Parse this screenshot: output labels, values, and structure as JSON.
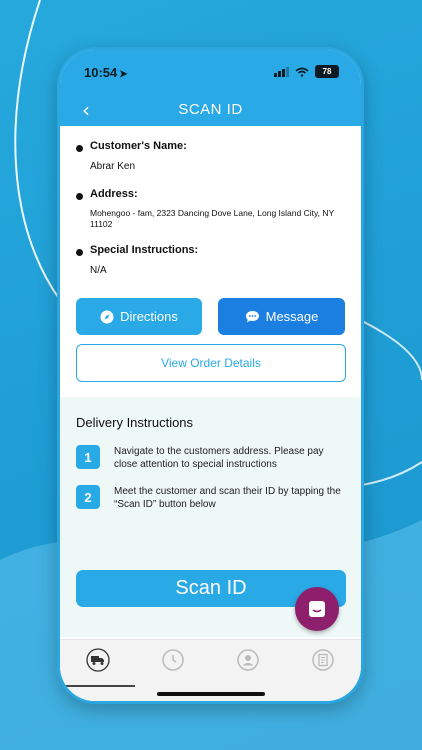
{
  "status_bar": {
    "time": "10:54",
    "battery": "78"
  },
  "header": {
    "title": "SCAN ID",
    "back_symbol": "‹"
  },
  "customer": {
    "name_label": "Customer's Name:",
    "name_value": "Abrar Ken",
    "address_label": "Address:",
    "address_value": "Mohengoo - fam, 2323 Dancing Dove Lane, Long Island City, NY 11102",
    "instructions_label": "Special Instructions:",
    "instructions_value": "N/A"
  },
  "buttons": {
    "directions": "Directions",
    "message": "Message",
    "view_order": "View Order Details",
    "scan_id": "Scan ID"
  },
  "delivery": {
    "title": "Delivery Instructions",
    "steps": [
      {
        "number": "1",
        "text": "Navigate to the customers address. Please pay close attention to special instructions"
      },
      {
        "number": "2",
        "text": "Meet the customer and scan their ID by tapping the “Scan ID” button below"
      }
    ]
  },
  "tab_bar": {
    "items": [
      {
        "icon": "delivery-truck-icon",
        "active": true
      },
      {
        "icon": "history-clock-icon",
        "active": false
      },
      {
        "icon": "profile-icon",
        "active": false
      },
      {
        "icon": "document-icon",
        "active": false
      }
    ]
  },
  "colors": {
    "primary": "#29a9e6",
    "message_button": "#1a7fe0",
    "chat_bubble": "#8d1f6c",
    "delivery_bg": "#eef8f6"
  }
}
